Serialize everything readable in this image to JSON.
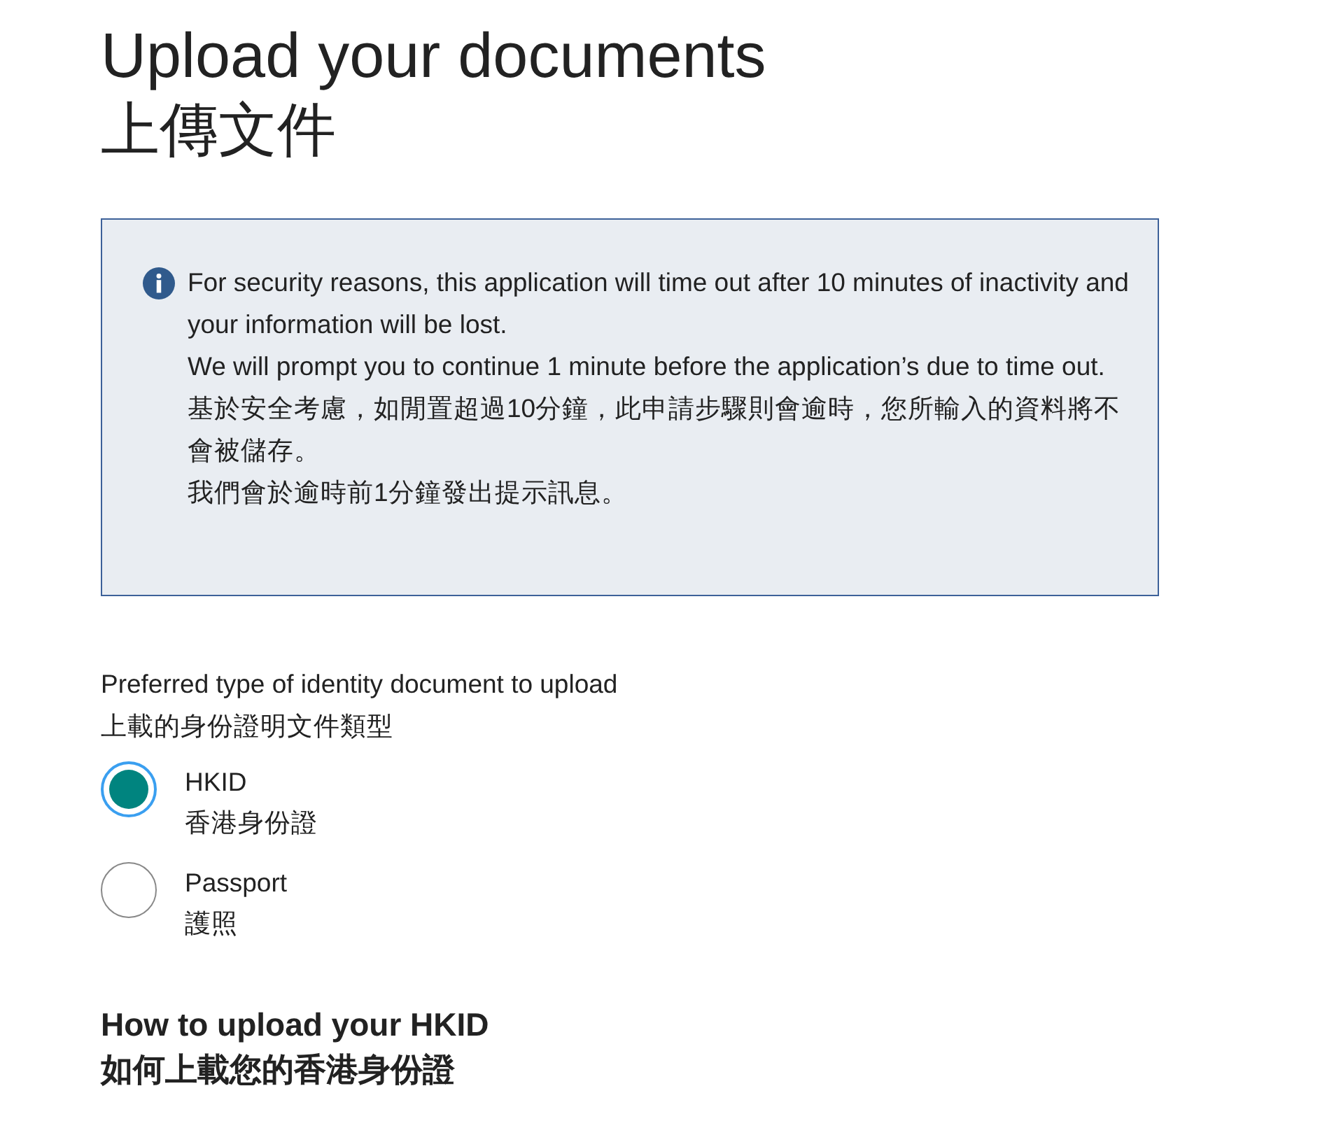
{
  "heading": {
    "title": "Upload your documents",
    "title_zh": "上傳文件"
  },
  "notice": {
    "lines": [
      "For security reasons, this application will time out after 10 minutes of inactivity and your information will be lost.",
      "We will prompt you to continue 1 minute before the application’s due to time out.",
      "基於安全考慮，如閒置超過10分鐘，此申請步驟則會逾時，您所輸入的資料將不會被儲存。",
      "我們會於逾時前1分鐘發出提示訊息。"
    ]
  },
  "document_type": {
    "label": "Preferred type of identity document to upload",
    "label_zh": "上載的身份證明文件類型",
    "options": [
      {
        "label": "HKID",
        "label_zh": "香港身份證",
        "selected": true
      },
      {
        "label": "Passport",
        "label_zh": "護照",
        "selected": false
      }
    ]
  },
  "section": {
    "title": "How to upload your HKID",
    "title_zh": "如何上載您的香港身份證"
  }
}
